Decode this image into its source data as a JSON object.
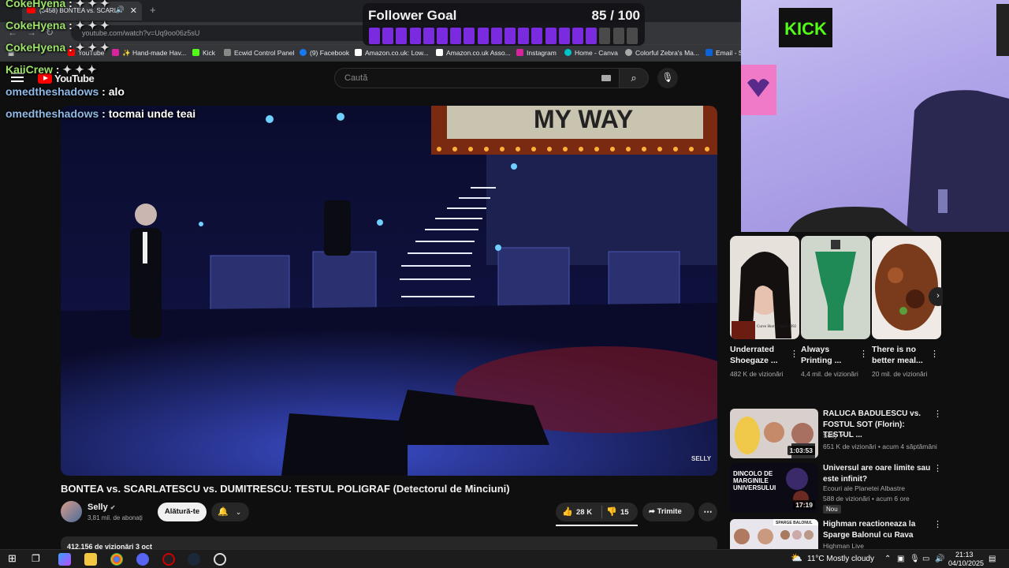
{
  "browser": {
    "tab_title": "(3458) BONTEA vs. SCARLA",
    "url": "youtube.com/watch?v=Uq9oo06z5sU",
    "bookmarks": [
      "YouTube",
      "✨ Hand-made Hav...",
      "Kick",
      "Ecwid Control Panel",
      "(9) Facebook",
      "Amazon.co.uk: Low...",
      "Amazon.co.uk Asso...",
      "Instagram",
      "Home - Canva",
      "Colorful Zebra's Ma...",
      "Email - S"
    ]
  },
  "youtube": {
    "logo_text": "YouTube",
    "search_placeholder": "Caută",
    "video_title": "BONTEA vs. SCARLATESCU vs. DUMITRESCU: TESTUL POLIGRAF (Detectorul de Minciuni)",
    "video_marquee": "MY WAY",
    "video_watermark": "SELLY",
    "channel_name": "Selly",
    "subscribers": "3,81 mil. de abonați",
    "join_label": "Alătură-te",
    "likes": "28 K",
    "dislikes": "15",
    "share_label": "Trimite",
    "description_snippet": "412.156 de vizionări  3 oct"
  },
  "chat": [
    {
      "user": "CokeHyena",
      "message": ""
    },
    {
      "user": "CokeHyena",
      "message": ""
    },
    {
      "user": "CokeHyena",
      "message": ""
    },
    {
      "user": "KaiiCrew",
      "message": ""
    },
    {
      "user": "omedtheshadows",
      "message": "alo"
    },
    {
      "user": "omedtheshadows",
      "message": "tocmai unde teai"
    }
  ],
  "follower_goal": {
    "title": "Follower Goal",
    "count": "85 / 100",
    "current": 85,
    "target": 100,
    "segments_total": 20,
    "color": "#7a2be0"
  },
  "webcam": {
    "sign_text": "KICK"
  },
  "shorts": [
    {
      "title": "Underrated Shoegaze ...",
      "views": "482 K de vizionări",
      "thumb_caption": "Curve Horror Head 1992"
    },
    {
      "title": "Always Printing ...",
      "views": "4,4 mil. de vizionări"
    },
    {
      "title": "There is no better meal...",
      "views": "20 mil. de vizionări"
    }
  ],
  "recommended": [
    {
      "title": "RALUCA BADULESCU vs. FOSTUL SOT (Florin): TESTUL ...",
      "channel": "Selly",
      "meta": "651 K de vizionări • acum 4 săptămâni",
      "duration": "1:03:53",
      "badge": ""
    },
    {
      "title": "Universul are oare limite sau este infinit?",
      "channel": "Ecouri ale Planetei Albastre",
      "meta": "588 de vizionări • acum 6 ore",
      "duration": "17:19",
      "badge": "Nou",
      "thumb_text": "DINCOLO DE MARGINILE UNIVERSULUI"
    },
    {
      "title": "Highman reactioneaza la Sparge Balonul cu Rava",
      "channel": "Highman Live",
      "meta": "",
      "duration": "",
      "badge": "",
      "thumb_text": "SPARGE BALONUL"
    }
  ],
  "taskbar": {
    "weather": "11°C  Mostly cloudy",
    "time": "21:13",
    "date": "04/10/2025"
  }
}
